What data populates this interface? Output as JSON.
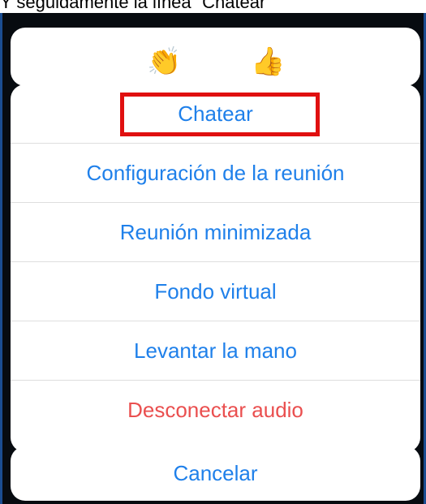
{
  "caption": {
    "text": "Y seguidamente la línea “Chatear”"
  },
  "reactions": {
    "clap": "👏",
    "thumbs_up": "👍"
  },
  "menu": {
    "items": [
      {
        "label": "Chatear",
        "style": "default",
        "highlighted": true
      },
      {
        "label": "Configuración de la reunión",
        "style": "default"
      },
      {
        "label": "Reunión minimizada",
        "style": "default"
      },
      {
        "label": "Fondo virtual",
        "style": "default"
      },
      {
        "label": "Levantar la mano",
        "style": "default"
      },
      {
        "label": "Desconectar audio",
        "style": "destructive"
      }
    ]
  },
  "cancel": {
    "label": "Cancelar"
  },
  "colors": {
    "accent": "#1f80ea",
    "destructive": "#ea4f4f",
    "highlight_border": "#e01010",
    "backdrop": "#070b10",
    "frame_border": "#1b4d91"
  }
}
